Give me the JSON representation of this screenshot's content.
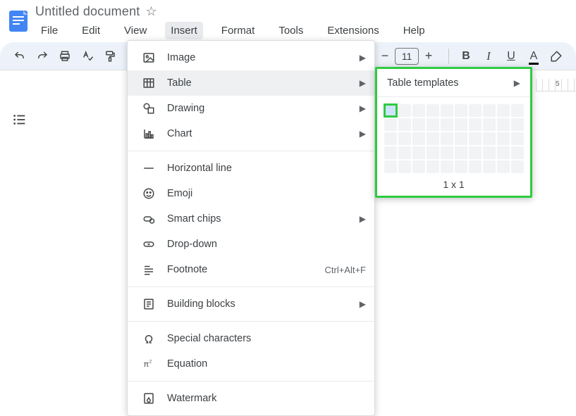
{
  "header": {
    "doc_title": "Untitled document",
    "menus": [
      "File",
      "Edit",
      "View",
      "Insert",
      "Format",
      "Tools",
      "Extensions",
      "Help"
    ],
    "active_menu_index": 3
  },
  "toolbar": {
    "font_size": "11"
  },
  "insert_menu": {
    "items": [
      {
        "label": "Image",
        "icon": "image",
        "submenu": true
      },
      {
        "label": "Table",
        "icon": "table",
        "submenu": true,
        "highlighted": true
      },
      {
        "label": "Drawing",
        "icon": "drawing",
        "submenu": true
      },
      {
        "label": "Chart",
        "icon": "chart",
        "submenu": true
      },
      {
        "separator": true
      },
      {
        "label": "Horizontal line",
        "icon": "hline"
      },
      {
        "label": "Emoji",
        "icon": "emoji"
      },
      {
        "label": "Smart chips",
        "icon": "chips",
        "submenu": true
      },
      {
        "label": "Drop-down",
        "icon": "dropdown"
      },
      {
        "label": "Footnote",
        "icon": "footnote",
        "shortcut": "Ctrl+Alt+F"
      },
      {
        "separator": true
      },
      {
        "label": "Building blocks",
        "icon": "blocks",
        "submenu": true
      },
      {
        "separator": true
      },
      {
        "label": "Special characters",
        "icon": "omega"
      },
      {
        "label": "Equation",
        "icon": "pi"
      },
      {
        "separator": true
      },
      {
        "label": "Watermark",
        "icon": "watermark"
      }
    ]
  },
  "table_submenu": {
    "templates_label": "Table templates",
    "grid_cols": 10,
    "grid_rows": 5,
    "selected": {
      "cols": 1,
      "rows": 1
    },
    "size_label": "1 x 1"
  },
  "ruler": {
    "mark": "5"
  }
}
